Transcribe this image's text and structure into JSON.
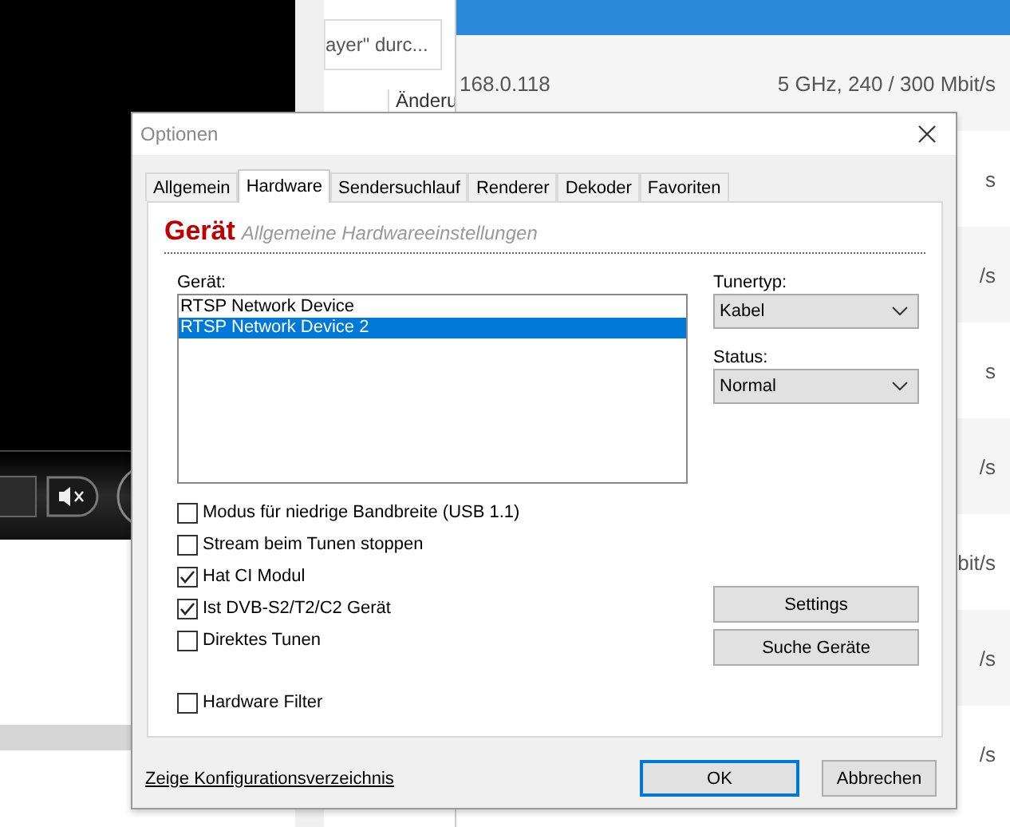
{
  "background": {
    "middle_window": {
      "field_text": "ayer\" durc...",
      "label": "Änderu"
    },
    "list_window": {
      "rows": [
        {
          "col_1": "168.0.118",
          "col_2": "5 GHz, 240 / 300 Mbit/s"
        },
        {
          "col_1": "",
          "col_2": "s"
        },
        {
          "col_1": "",
          "col_2": "/s"
        },
        {
          "col_1": "",
          "col_2": "s"
        },
        {
          "col_1": "",
          "col_2": "/s"
        },
        {
          "col_1": "",
          "col_2": "bit/s"
        },
        {
          "col_1": "",
          "col_2": "/s"
        },
        {
          "col_1": "",
          "col_2": "/s"
        }
      ]
    }
  },
  "dialog": {
    "title": "Optionen",
    "tabs": [
      {
        "label": "Allgemein",
        "selected": false
      },
      {
        "label": "Hardware",
        "selected": true
      },
      {
        "label": "Sendersuchlauf",
        "selected": false
      },
      {
        "label": "Renderer",
        "selected": false
      },
      {
        "label": "Dekoder",
        "selected": false
      },
      {
        "label": "Favoriten",
        "selected": false
      }
    ],
    "heading": "Gerät",
    "subheading": "Allgemeine Hardwareeinstellungen",
    "device_label": "Gerät:",
    "devices": [
      {
        "label": "RTSP Network Device",
        "selected": false
      },
      {
        "label": "RTSP Network Device 2",
        "selected": true
      }
    ],
    "tuner_type": {
      "label": "Tunertyp:",
      "value": "Kabel"
    },
    "status": {
      "label": "Status:",
      "value": "Normal"
    },
    "checkboxes": [
      {
        "label": "Modus für niedrige Bandbreite (USB 1.1)",
        "checked": false
      },
      {
        "label": "Stream beim Tunen stoppen",
        "checked": false
      },
      {
        "label": "Hat CI Modul",
        "checked": true
      },
      {
        "label": "Ist DVB-S2/T2/C2 Gerät",
        "checked": true
      },
      {
        "label": "Direktes Tunen",
        "checked": false
      },
      {
        "label": "Hardware Filter",
        "checked": false
      }
    ],
    "side_buttons": [
      "Settings",
      "Suche Geräte"
    ],
    "link": "Zeige Konfigurationsverzeichnis",
    "ok": "OK",
    "cancel": "Abbrechen"
  }
}
